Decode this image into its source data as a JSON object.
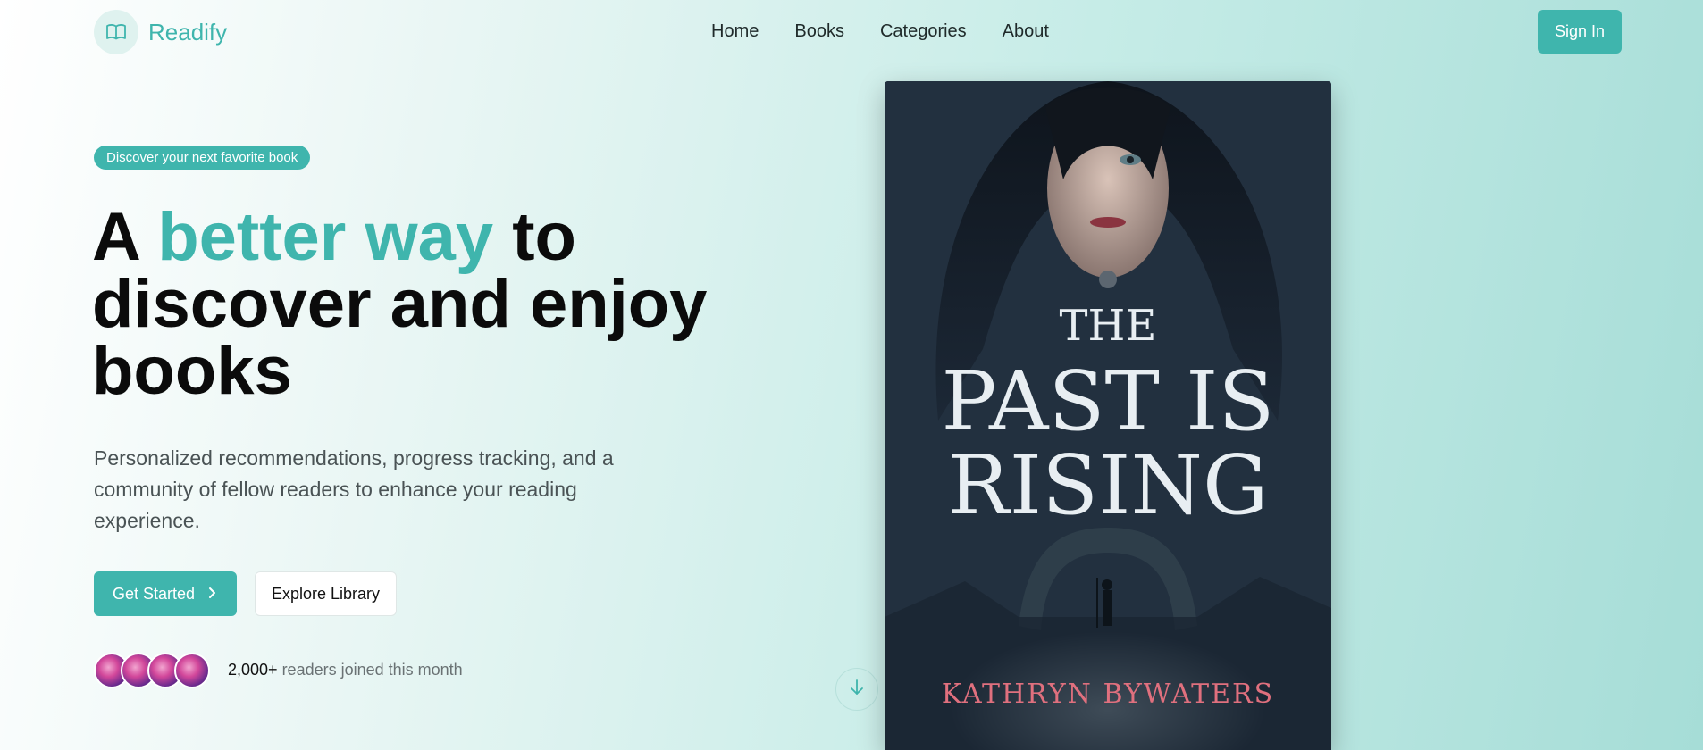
{
  "brand": {
    "name": "Readify",
    "logo_icon": "book-open-icon"
  },
  "nav": {
    "links": [
      "Home",
      "Books",
      "Categories",
      "About"
    ],
    "signin_label": "Sign In"
  },
  "hero": {
    "badge": "Discover your next favorite book",
    "headline": {
      "part1": "A ",
      "accent": "better way",
      "part2": " to discover and enjoy books"
    },
    "subtitle": "Personalized recommendations, progress tracking, and a community of fellow readers to enhance your reading experience.",
    "primary_button": "Get Started",
    "secondary_button": "Explore Library",
    "social_proof": {
      "count": "2,000+",
      "text": " readers joined this month"
    }
  },
  "book": {
    "title_line1": "THE",
    "title_line2": "PAST IS",
    "title_line3": "RISING",
    "author": "KATHRYN BYWATERS"
  },
  "colors": {
    "accent": "#3fb5ad",
    "author": "#e0707e"
  }
}
